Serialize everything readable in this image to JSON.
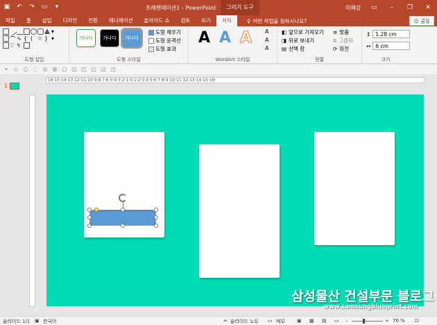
{
  "window": {
    "title": "프레젠테이션1 - PowerPoint",
    "context_tab": "그리기 도구",
    "user": "이혜강",
    "qat_icons": [
      "save-icon",
      "undo-icon",
      "redo-icon",
      "start-slideshow-icon",
      "customize-icon"
    ],
    "controls": [
      "minimize-icon",
      "restore-icon",
      "close-icon"
    ]
  },
  "tabs": [
    {
      "label": "파일"
    },
    {
      "label": "홈"
    },
    {
      "label": "삽입"
    },
    {
      "label": "디자인"
    },
    {
      "label": "전환"
    },
    {
      "label": "애니메이션"
    },
    {
      "label": "슬라이드 쇼"
    },
    {
      "label": "검토"
    },
    {
      "label": "보기"
    },
    {
      "label": "서식",
      "active": true
    }
  ],
  "tell_me": "어떤 작업을 원하시나요?",
  "share_label": "공유",
  "ribbon": {
    "groups": {
      "insert_shapes": "도형 삽입",
      "shape_styles": "도형 스타일",
      "wordart_styles": "WordArt 스타일",
      "arrange": "정렬",
      "size": "크기"
    },
    "style_samples": [
      "가나다",
      "가나다",
      "가나다"
    ],
    "shape_fill": "도형 채우기",
    "shape_outline": "도형 윤곽선",
    "shape_effects": "도형 효과",
    "wordart_letters": [
      "A",
      "A",
      "A"
    ],
    "bring_forward": "앞으로 가져오기",
    "send_backward": "뒤로 보내기",
    "selection_pane": "선택 창",
    "align": "맞춤",
    "group": "그룹화",
    "rotate": "회전",
    "height": "1.28 cm",
    "width": "6 cm",
    "colors": {
      "accent": "#b7472a",
      "slide_bg": "#00dcb4",
      "shape_fill": "#5b9bd5"
    }
  },
  "slide_panel": {
    "number": "1"
  },
  "ruler_text": "·16·15·14·13·12·11·10·9·8·7·6·5·4·3·2·1·0·1·2·3·4·5·6·7·8·9·10·11·12·13·14·15·16·",
  "watermark": {
    "title": "삼성물산 건설부문 블로그",
    "url": "www.samsungblueprint.com"
  },
  "status": {
    "slide": "슬라이드 1/1",
    "language": "한국어",
    "notes": "슬라이드 노트",
    "comments": "메모",
    "zoom": "76 %",
    "zoom_fraction": 0.76
  }
}
